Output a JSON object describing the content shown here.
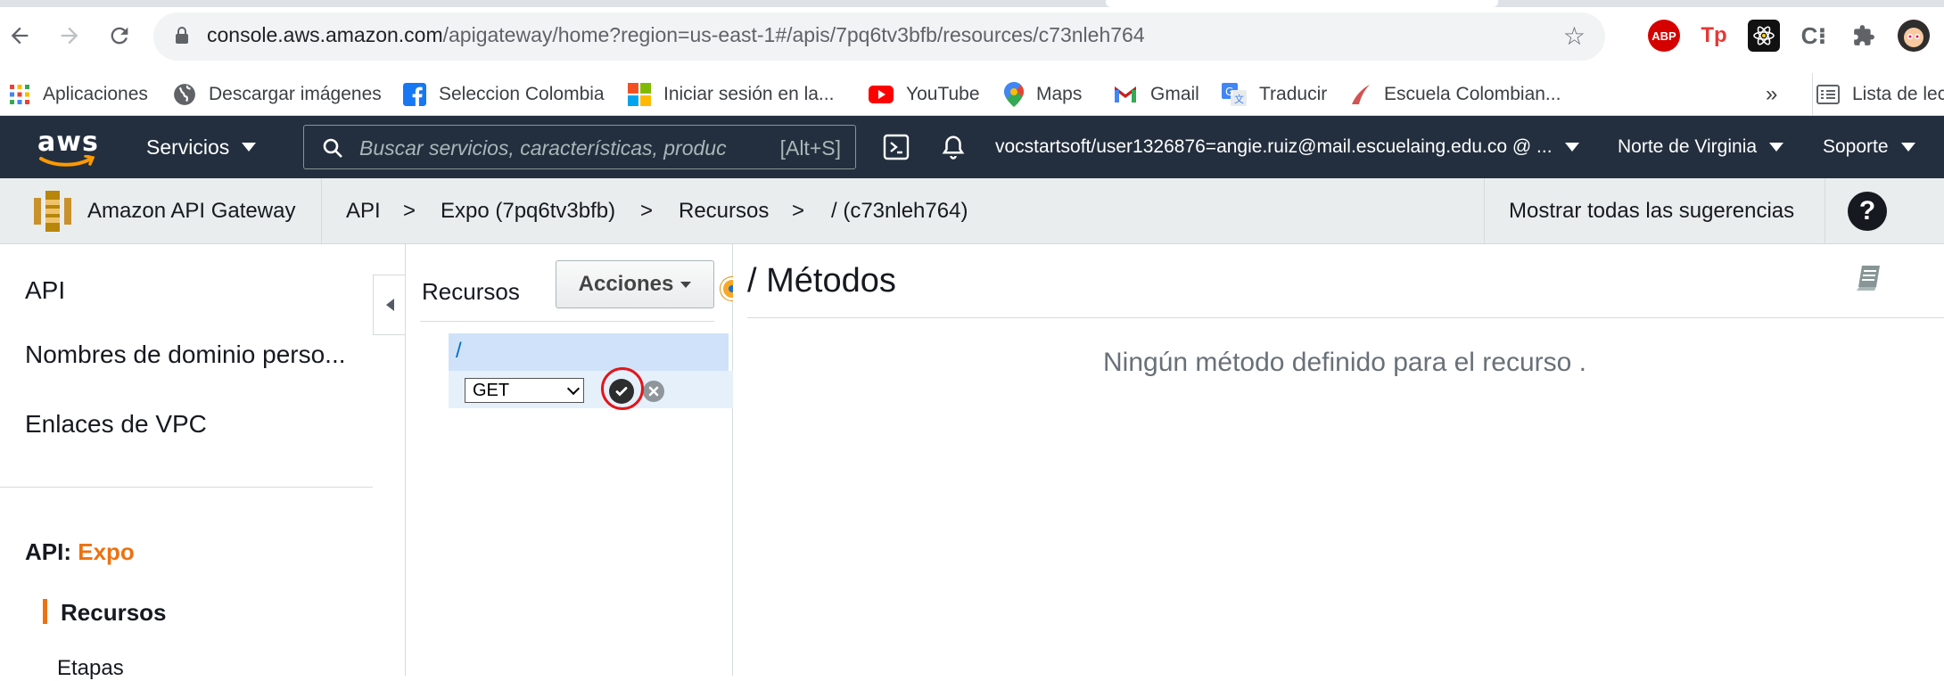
{
  "browser": {
    "url_host": "console.aws.amazon.com",
    "url_path": "/apigateway/home?region=us-east-1#/apis/7pq6tv3bfb/resources/c73nleh764",
    "extensions": [
      "ABP",
      "Tp",
      "C⁝"
    ],
    "bookmarks": [
      {
        "label": "Aplicaciones",
        "icon": "apps-grid-icon"
      },
      {
        "label": "Descargar imágenes",
        "icon": "globe-icon"
      },
      {
        "label": "Seleccion Colombia",
        "icon": "facebook-icon"
      },
      {
        "label": "Iniciar sesión en la...",
        "icon": "microsoft-icon"
      },
      {
        "label": "YouTube",
        "icon": "youtube-icon"
      },
      {
        "label": "Maps",
        "icon": "maps-icon"
      },
      {
        "label": "Gmail",
        "icon": "gmail-icon"
      },
      {
        "label": "Traducir",
        "icon": "translate-icon"
      },
      {
        "label": "Escuela Colombian...",
        "icon": "escuela-icon"
      }
    ],
    "more_bookmarks": "»",
    "reading_list": "Lista de lec"
  },
  "aws_nav": {
    "logo": "aws",
    "services": "Servicios",
    "search_placeholder": "Buscar servicios, características, produc",
    "search_shortcut": "[Alt+S]",
    "account": "vocstartsoft/user1326876=angie.ruiz@mail.escuelaing.edu.co @ ...",
    "region": "Norte de Virginia",
    "support": "Soporte"
  },
  "service_bar": {
    "service_name": "Amazon API Gateway",
    "breadcrumb": [
      "API",
      "Expo (7pq6tv3bfb)",
      "Recursos",
      "/ (c73nleh764)"
    ],
    "separator": ">",
    "suggestions": "Mostrar todas las sugerencias",
    "help": "?"
  },
  "left_nav": {
    "items": [
      "API",
      "Nombres de dominio perso...",
      "Enlaces de VPC"
    ],
    "api_prefix": "API:",
    "api_name": "Expo",
    "sub_items": [
      "Recursos",
      "Etapas"
    ]
  },
  "resources": {
    "title": "Recursos",
    "actions": "Acciones",
    "root": "/",
    "method_value": "GET"
  },
  "main": {
    "title": "/ Métodos",
    "empty_message": "Ningún método definido para el recurso ."
  },
  "colors": {
    "aws_nav_bg": "#232f3e",
    "accent_orange": "#ec7211",
    "link_blue": "#0073bb",
    "highlight_ring": "#e3151a"
  }
}
